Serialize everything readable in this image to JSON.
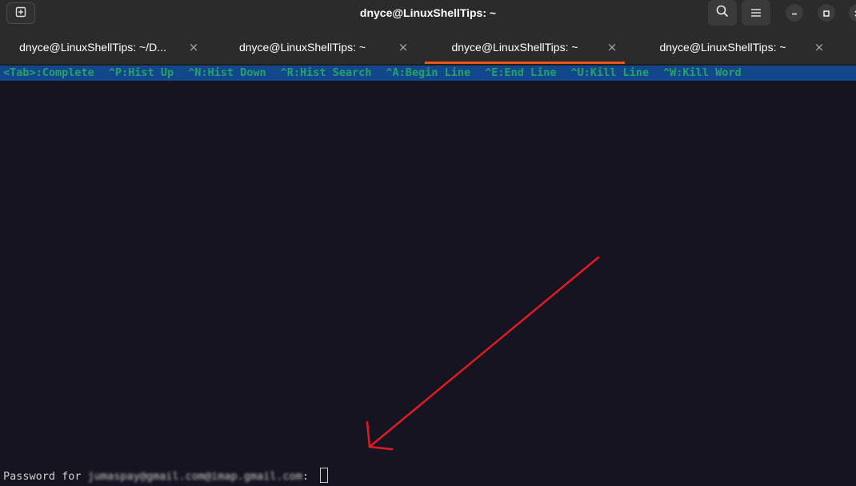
{
  "window": {
    "title": "dnyce@LinuxShellTips: ~"
  },
  "header": {
    "new_tab_icon": "new-tab-icon",
    "search_icon": "search-icon",
    "menu_icon": "hamburger-menu-icon"
  },
  "tabs": [
    {
      "label": "dnyce@LinuxShellTips: ~/D...",
      "active": false
    },
    {
      "label": "dnyce@LinuxShellTips: ~",
      "active": false
    },
    {
      "label": "dnyce@LinuxShellTips: ~",
      "active": true
    },
    {
      "label": "dnyce@LinuxShellTips: ~",
      "active": false
    }
  ],
  "tab_close_glyph": "×",
  "terminal": {
    "hints": [
      "<Tab>:Complete",
      "^P:Hist Up",
      "^N:Hist Down",
      "^R:Hist Search",
      "^A:Begin Line",
      "^E:End Line",
      "^U:Kill Line",
      "^W:Kill Word"
    ],
    "prompt_prefix": "Password for ",
    "prompt_email": "jumaspay@gmail.com@imap.gmail.com",
    "prompt_suffix": ": "
  },
  "colors": {
    "terminal_bg": "#171421",
    "hint_bar_bg": "#12488b",
    "hint_text": "#26a269",
    "active_tab_accent": "#e95420",
    "annotation_arrow": "#e01b24"
  }
}
